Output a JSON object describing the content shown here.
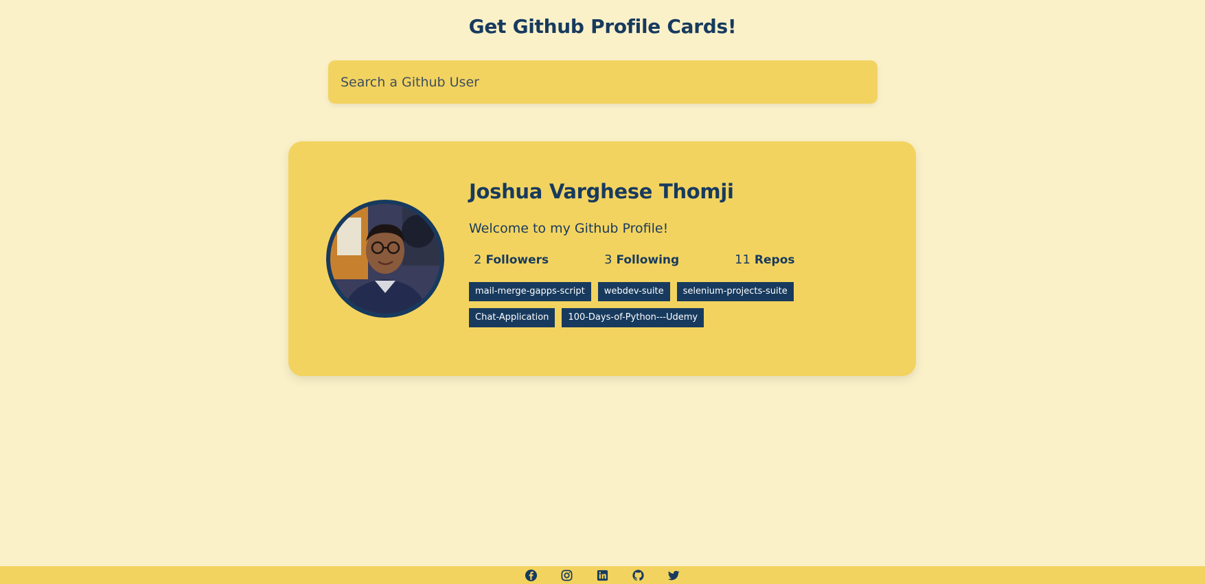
{
  "header": {
    "title": "Get Github Profile Cards!"
  },
  "search": {
    "placeholder": "Search a Github User",
    "value": ""
  },
  "profile": {
    "name": "Joshua Varghese Thomji",
    "bio": "Welcome to my Github Profile!",
    "avatar_alt": "Joshua Varghese Thomji",
    "stats": [
      {
        "value": "2",
        "label": "Followers"
      },
      {
        "value": "3",
        "label": "Following"
      },
      {
        "value": "11",
        "label": "Repos"
      }
    ],
    "repos": [
      "mail-merge-gapps-script",
      "webdev-suite",
      "selenium-projects-suite",
      "Chat-Application",
      "100-Days-of-Python---Udemy"
    ]
  },
  "footer": {
    "icons": [
      "facebook-icon",
      "instagram-icon",
      "linkedin-icon",
      "github-icon",
      "twitter-icon"
    ]
  },
  "colors": {
    "background": "#fbf1c9",
    "accent": "#f3d35f",
    "primary": "#173a5e"
  }
}
